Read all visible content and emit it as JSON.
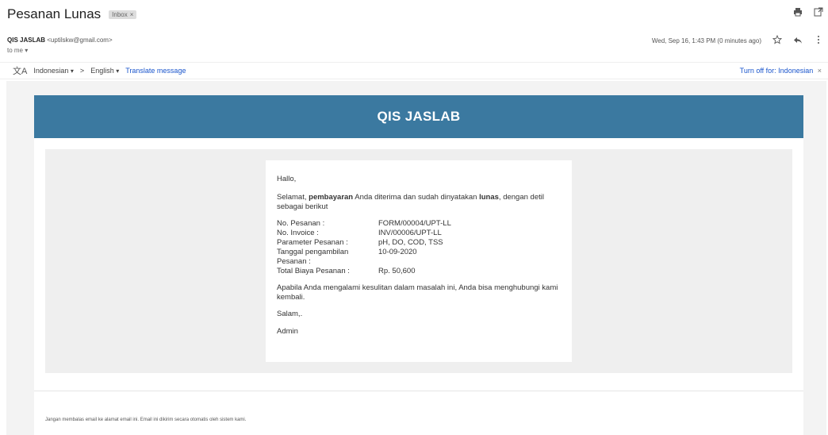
{
  "email": {
    "subject": "Pesanan Lunas",
    "label_chip": "Inbox",
    "label_chip_close": "×",
    "sender_name": "QIS JASLAB",
    "sender_email": "<uptilskw@gmail.com>",
    "recipient": "to me",
    "timestamp": "Wed, Sep 16, 1:43 PM (0 minutes ago)"
  },
  "translate": {
    "source_lang": "Indonesian",
    "arrow": ">",
    "target_lang": "English",
    "action": "Translate message",
    "turn_off": "Turn off for: Indonesian"
  },
  "message": {
    "header": "QIS JASLAB",
    "greeting": "Hallo,",
    "intro_pre": "Selamat, ",
    "intro_bold1": "pembayaran",
    "intro_mid": " Anda diterima dan sudah dinyatakan ",
    "intro_bold2": "lunas",
    "intro_post": ", dengan detil sebagai berikut",
    "details": [
      {
        "label": "No. Pesanan :",
        "value": "FORM/00004/UPT-LL"
      },
      {
        "label": "No. Invoice :",
        "value": "INV/00006/UPT-LL"
      },
      {
        "label": "Parameter Pesanan :",
        "value": "pH, DO, COD, TSS"
      },
      {
        "label": "Tanggal pengambilan Pesanan :",
        "value": "10-09-2020"
      },
      {
        "label": "Total Biaya Pesanan :",
        "value": "Rp. 50,600"
      }
    ],
    "closing": "Apabila Anda mengalami kesulitan dalam masalah ini, Anda bisa menghubungi kami kembali.",
    "salam": "Salam,.",
    "signature": "Admin",
    "footer": "Jangan membalas email ke alamat email ini. Email ini dikirim secara otomatis oleh sistem kami."
  },
  "colors": {
    "banner": "#3b79a0",
    "link": "#1a55cc"
  }
}
